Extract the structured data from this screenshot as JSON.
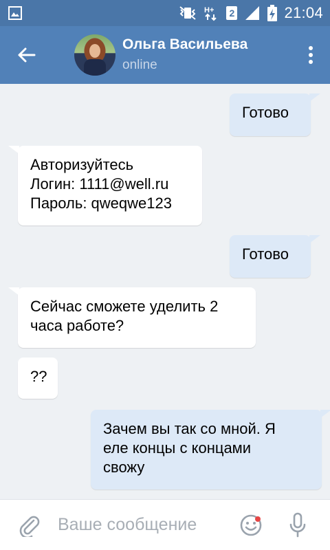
{
  "status_bar": {
    "time": "21:04",
    "sim_slot": "2",
    "network": "H+",
    "icons": [
      "image-icon",
      "mute-vibrate-icon",
      "hplus-network-icon",
      "signal-icon",
      "battery-charging-icon"
    ]
  },
  "app_bar": {
    "contact_name": "Ольга Васильева",
    "contact_status": "online",
    "icons": [
      "back-arrow-icon",
      "more-vert-icon"
    ]
  },
  "messages": [
    {
      "direction": "out",
      "lines": [
        "Готово"
      ]
    },
    {
      "direction": "in",
      "lines": [
        "Авторизуйтесь",
        "Логин: 1111@well.ru",
        "Пароль: qweqwe123"
      ]
    },
    {
      "direction": "out",
      "lines": [
        "Готово"
      ]
    },
    {
      "direction": "in",
      "lines": [
        "Сейчас сможете уделить 2",
        "часа работе?"
      ]
    },
    {
      "direction": "in",
      "lines": [
        "??"
      ]
    },
    {
      "direction": "out",
      "lines": [
        "Зачем вы так со мной. Я",
        "еле концы с концами",
        "свожу"
      ]
    }
  ],
  "composer": {
    "placeholder": "Ваше сообщение",
    "value": "",
    "icons": [
      "paperclip-icon",
      "emoji-icon",
      "microphone-icon"
    ]
  },
  "colors": {
    "header": "#5181b8",
    "status_bar": "#4a76a8",
    "chat_bg": "#eef1f4",
    "incoming_bubble": "#ffffff",
    "outgoing_bubble": "#dde9f7",
    "notification_dot": "#e64646"
  }
}
